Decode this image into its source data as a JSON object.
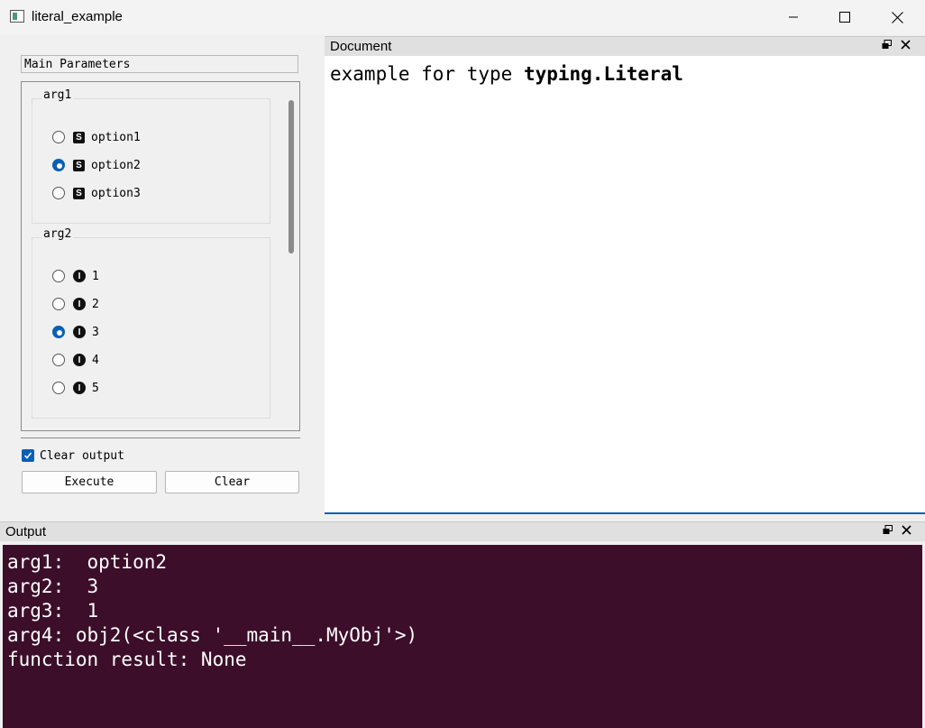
{
  "window": {
    "title": "literal_example",
    "controls": [
      "minimize-icon",
      "maximize-icon",
      "close-icon"
    ]
  },
  "params": {
    "group_title": "Main Parameters",
    "arg1": {
      "title": "arg1",
      "type_badge": "S",
      "options": [
        "option1",
        "option2",
        "option3"
      ],
      "selected": "option2"
    },
    "arg2": {
      "title": "arg2",
      "type_badge": "I",
      "options": [
        "1",
        "2",
        "3",
        "4",
        "5"
      ],
      "selected": "3"
    },
    "clear_output": {
      "label": "Clear output",
      "checked": true
    },
    "execute_label": "Execute",
    "clear_label": "Clear"
  },
  "document": {
    "title": "Document",
    "text_prefix": "example for type ",
    "text_bold": "typing.Literal"
  },
  "output": {
    "title": "Output",
    "lines": [
      "arg1:  option2",
      "arg2:  3",
      "arg3:  1",
      "arg4: obj2(<class '__main__.MyObj'>)",
      "function result: None"
    ],
    "background": "#3c0e29"
  },
  "colors": {
    "accent": "#0a5fb5"
  }
}
